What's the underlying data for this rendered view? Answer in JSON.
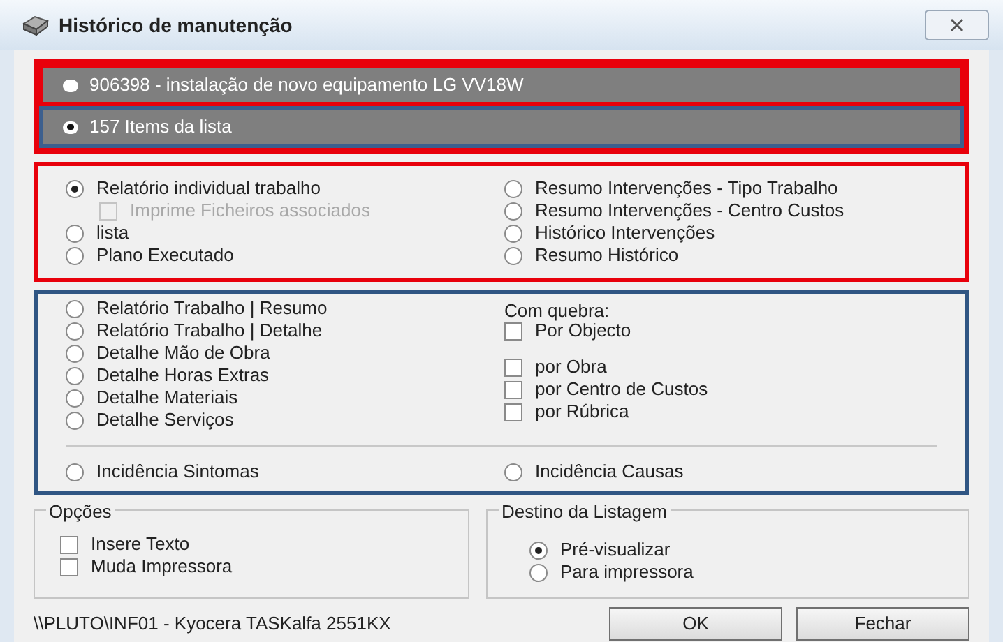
{
  "window": {
    "title": "Histórico de manutenção"
  },
  "scope": [
    {
      "label": "906398 - instalação de novo equipamento LG VV18W",
      "selected": false
    },
    {
      "label": "157 Items da lista",
      "selected": true
    }
  ],
  "report_types": {
    "left": [
      {
        "kind": "radio",
        "label": "Relatório individual trabalho",
        "selected": true,
        "disabled": false
      },
      {
        "kind": "checkbox",
        "label": "Imprime Ficheiros associados",
        "checked": false,
        "disabled": true
      },
      {
        "kind": "radio",
        "label": "lista",
        "selected": false,
        "disabled": false
      },
      {
        "kind": "radio",
        "label": "Plano Executado",
        "selected": false,
        "disabled": false
      }
    ],
    "right": [
      {
        "kind": "radio",
        "label": "Resumo Intervenções - Tipo Trabalho",
        "selected": false,
        "disabled": false
      },
      {
        "kind": "radio",
        "label": "Resumo Intervenções - Centro Custos",
        "selected": false,
        "disabled": false
      },
      {
        "kind": "radio",
        "label": "Histórico Intervenções",
        "selected": false,
        "disabled": false
      },
      {
        "kind": "radio",
        "label": "Resumo Histórico",
        "selected": false,
        "disabled": false
      }
    ]
  },
  "detail_reports": {
    "left": [
      {
        "label": "Relatório Trabalho | Resumo",
        "selected": false
      },
      {
        "label": "Relatório Trabalho | Detalhe",
        "selected": false
      },
      {
        "label": "Detalhe Mão de Obra",
        "selected": false
      },
      {
        "label": "Detalhe Horas Extras",
        "selected": false
      },
      {
        "label": "Detalhe Materiais",
        "selected": false
      },
      {
        "label": "Detalhe Serviços",
        "selected": false
      }
    ],
    "break_label": "Com quebra:",
    "breaks": [
      {
        "label": "Por Objecto",
        "checked": false
      },
      {
        "label": "por Obra",
        "checked": false
      },
      {
        "label": "por Centro de Custos",
        "checked": false
      },
      {
        "label": "por Rúbrica",
        "checked": false
      }
    ],
    "incidence": [
      {
        "label": "Incidência Sintomas",
        "selected": false
      },
      {
        "label": "Incidência Causas",
        "selected": false
      }
    ]
  },
  "options": {
    "title": "Opções",
    "items": [
      {
        "label": "Insere Texto",
        "checked": false
      },
      {
        "label": "Muda Impressora",
        "checked": false
      }
    ]
  },
  "destination": {
    "title": "Destino da Listagem",
    "items": [
      {
        "label": "Pré-visualizar",
        "selected": true
      },
      {
        "label": "Para impressora",
        "selected": false
      }
    ]
  },
  "printer": "\\\\PLUTO\\INF01 - Kyocera TASKalfa 2551KX",
  "buttons": [
    "OK",
    "Fechar"
  ]
}
